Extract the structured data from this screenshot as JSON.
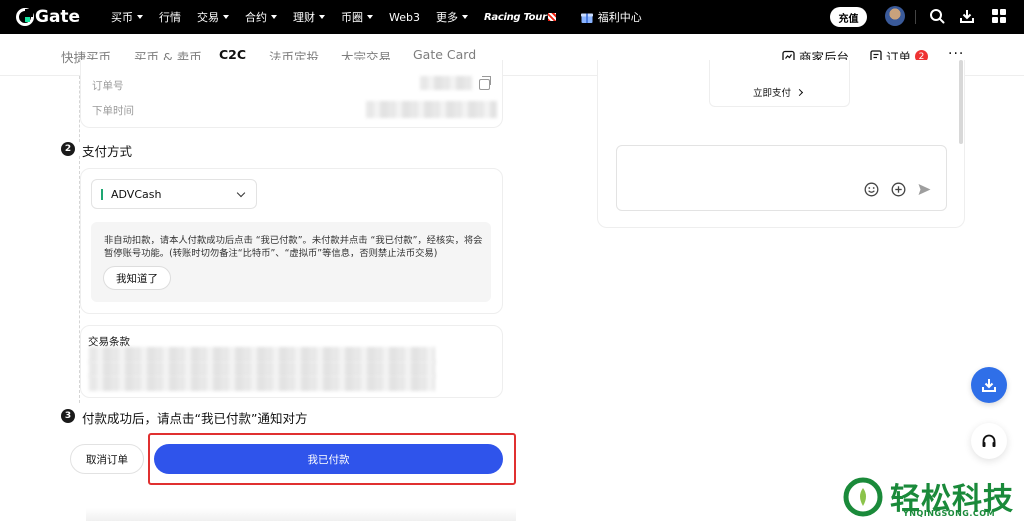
{
  "topnav": {
    "logo_text": "Gate",
    "items": [
      {
        "label": "买币",
        "caret": true
      },
      {
        "label": "行情",
        "caret": false
      },
      {
        "label": "交易",
        "caret": true
      },
      {
        "label": "合约",
        "caret": true
      },
      {
        "label": "理财",
        "caret": true
      },
      {
        "label": "币圈",
        "caret": true
      },
      {
        "label": "Web3",
        "caret": false
      },
      {
        "label": "更多",
        "caret": true
      }
    ],
    "racing_label": "Racing Tour",
    "welfare_label": "福利中心",
    "recharge_label": "充值"
  },
  "subnav": {
    "tabs": [
      {
        "label": "快捷买币",
        "active": false
      },
      {
        "label": "买币 & 卖币",
        "active": false
      },
      {
        "label": "C2C",
        "active": true
      },
      {
        "label": "法币定投",
        "active": false
      },
      {
        "label": "大宗交易",
        "active": false
      },
      {
        "label": "Gate Card",
        "active": false
      }
    ],
    "merchant_label": "商家后台",
    "orders_label": "订单",
    "orders_badge": "2",
    "more_label": "···"
  },
  "order_info": {
    "order_no_label": "订单号",
    "order_time_label": "下单时间"
  },
  "step2": {
    "number": "2",
    "title": "支付方式",
    "method": "ADVCash",
    "notice": "非自动扣款，请本人付款成功后点击 “我已付款”。未付款并点击 “我已付款”，经核实，将会暂停账号功能。(转账时切勿备注“比特币”、“虚拟币”等信息，否则禁止法币交易)",
    "ack_button": "我知道了",
    "terms_label": "交易条款"
  },
  "step3": {
    "number": "3",
    "title": "付款成功后，请点击“我已付款”通知对方"
  },
  "actions": {
    "cancel_label": "取消订单",
    "paid_label": "我已付款"
  },
  "chat": {
    "pay_now_label": "立即支付"
  },
  "watermark": {
    "title": "轻松科技",
    "subtitle": "YNQINGSONG.COM"
  }
}
